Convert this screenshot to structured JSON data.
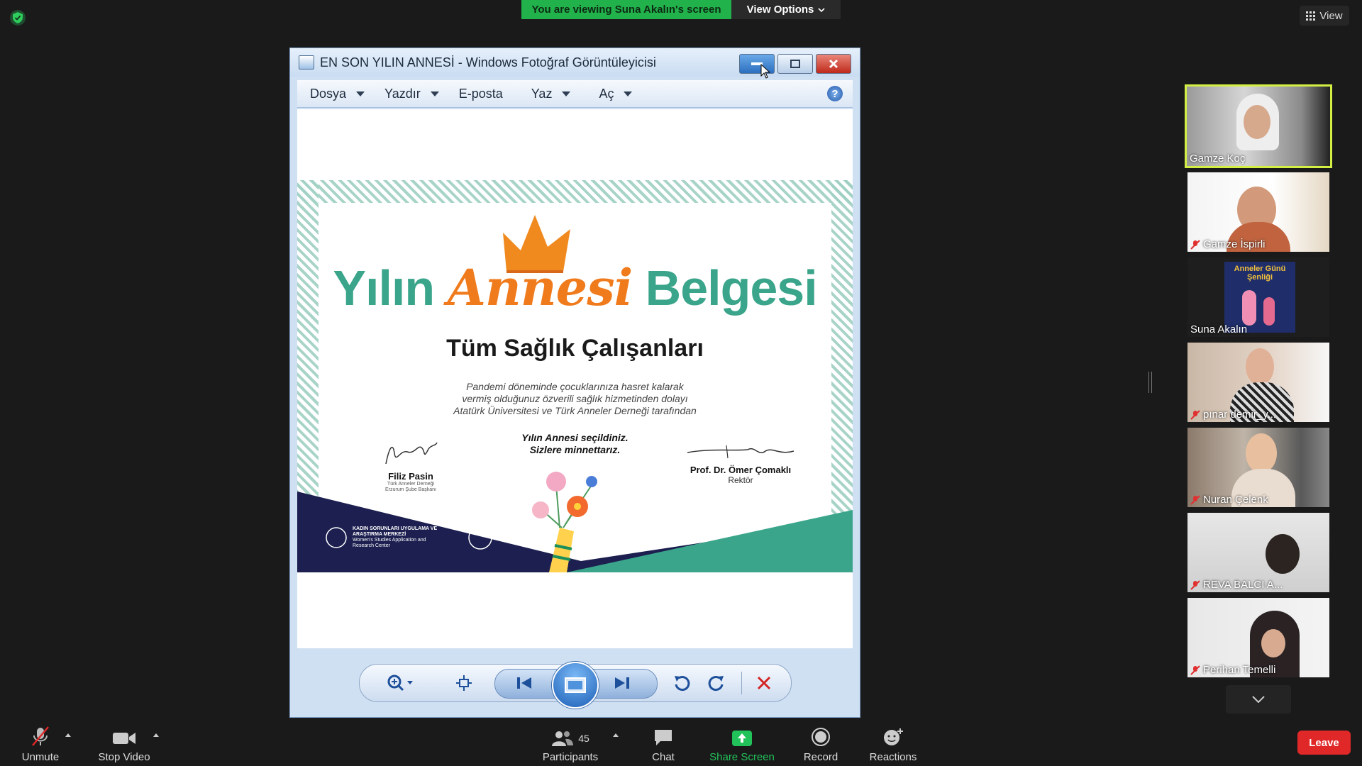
{
  "top": {
    "banner": "You are viewing Suna Akalın's screen",
    "view_options": "View Options",
    "view": "View"
  },
  "window": {
    "title": "EN SON YILIN ANNESİ - Windows Fotoğraf Görüntüleyicisi",
    "menus": [
      "Dosya",
      "Yazdır",
      "E-posta",
      "Yaz",
      "Aç"
    ],
    "help": "?"
  },
  "certificate": {
    "title_left": "Yılın",
    "title_mid": "Annesi",
    "title_right": "Belgesi",
    "subtitle": "Tüm Sağlık Çalışanları",
    "body_lines": [
      "Pandemi döneminde çocuklarınıza hasret kalarak",
      "vermiş olduğunuz özverili sağlık hizmetinden dolayı",
      "Atatürk Üniversitesi ve Türk Anneler Derneği tarafından"
    ],
    "bold_lines": [
      "Yılın Annesi seçildiniz.",
      "Sizlere minnettarız."
    ],
    "sig_left_name": "Filiz Pasin",
    "sig_left_role_1": "Türk Anneler Derneği",
    "sig_left_role_2": "Erzurum Şube Başkanı",
    "sig_right_name": "Prof. Dr. Ömer Çomaklı",
    "sig_right_role": "Rektör",
    "org_line_1": "KADIN SORUNLARI UYGULAMA VE",
    "org_line_2": "ARAŞTIRMA MERKEZİ",
    "org_line_3": "Women's Studies Application and",
    "org_line_4": "Research Center"
  },
  "participants": [
    {
      "name": "Gamze Koç",
      "muted": false,
      "active": true
    },
    {
      "name": "Gamze İspirli",
      "muted": true,
      "active": false
    },
    {
      "name": "Suna Akalın",
      "muted": false,
      "active": false
    },
    {
      "name": "pınar demir_y...",
      "muted": true,
      "active": false
    },
    {
      "name": "Nuran Çelenk",
      "muted": true,
      "active": false
    },
    {
      "name": "REVA BALCI A...",
      "muted": true,
      "active": false
    },
    {
      "name": "Perihan Temelli",
      "muted": true,
      "active": false
    }
  ],
  "suna_tile_text": "Anneler Günü Şenliği",
  "bottom": {
    "unmute": "Unmute",
    "stop_video": "Stop Video",
    "participants": "Participants",
    "participants_count": "45",
    "chat": "Chat",
    "share_screen": "Share Screen",
    "record": "Record",
    "reactions": "Reactions",
    "leave": "Leave"
  },
  "colors": {
    "banner": "#22b24c",
    "active_speaker": "#d3ef43",
    "leave": "#e02828",
    "cert_green": "#3aa58a",
    "cert_orange": "#f07b1d"
  },
  "icons": [
    "shield-icon",
    "grid-icon",
    "chevron-down-icon",
    "minimize-icon",
    "maximize-icon",
    "close-icon",
    "help-icon",
    "zoom-icon",
    "fit-icon",
    "previous-icon",
    "slideshow-icon",
    "next-icon",
    "rotate-left-icon",
    "rotate-right-icon",
    "delete-icon",
    "mic-muted-icon",
    "video-icon",
    "participants-icon",
    "chat-icon",
    "share-screen-icon",
    "record-icon",
    "reactions-icon"
  ]
}
